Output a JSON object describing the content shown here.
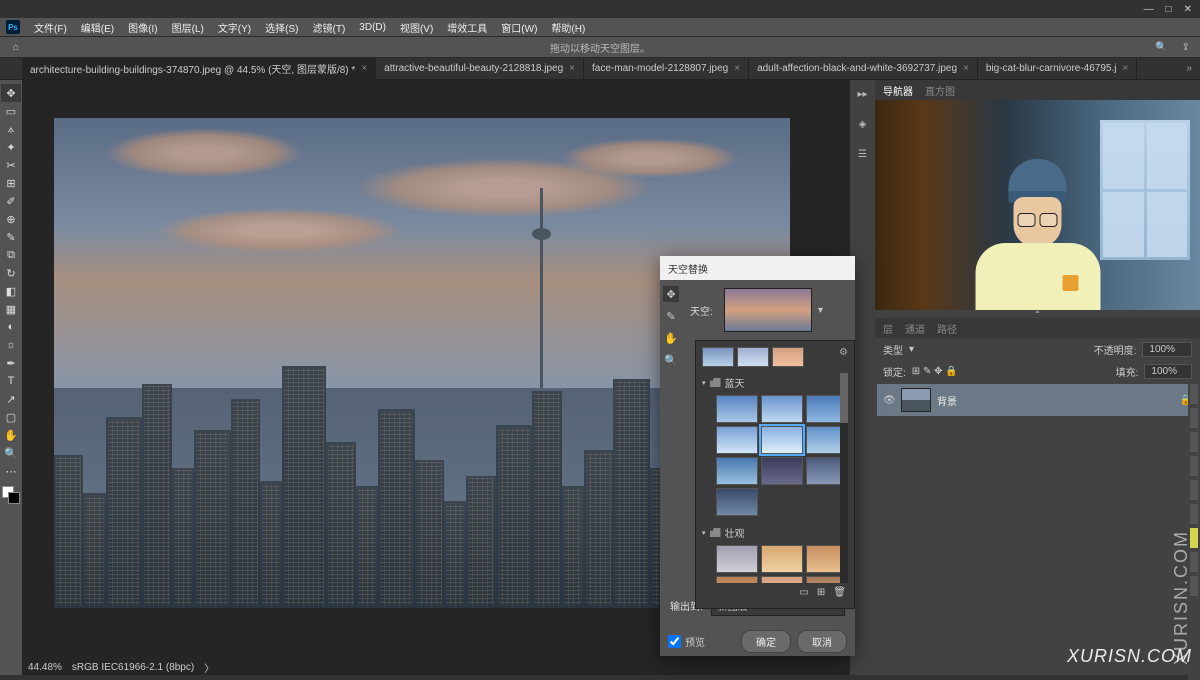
{
  "menubar": {
    "items": [
      "文件(F)",
      "编辑(E)",
      "图像(I)",
      "图层(L)",
      "文字(Y)",
      "选择(S)",
      "滤镜(T)",
      "3D(D)",
      "视图(V)",
      "增效工具",
      "窗口(W)",
      "帮助(H)"
    ]
  },
  "optbar": {
    "hint": "拖动以移动天空图层。"
  },
  "tabs": [
    {
      "label": "architecture-building-buildings-374870.jpeg @ 44.5% (天空, 图层蒙版/8) *",
      "active": true
    },
    {
      "label": "attractive-beautiful-beauty-2128818.jpeg",
      "active": false
    },
    {
      "label": "face-man-model-2128807.jpeg",
      "active": false
    },
    {
      "label": "adult-affection-black-and-white-3692737.jpeg",
      "active": false
    },
    {
      "label": "big-cat-blur-carnivore-46795.j",
      "active": false
    }
  ],
  "status": {
    "zoom": "44.48%",
    "profile": "sRGB IEC61966-2.1 (8bpc)"
  },
  "navigator": {
    "tab1": "导航器",
    "tab2": "直方图"
  },
  "layers": {
    "tab_layers": "层",
    "tab_channels": "通道",
    "tab_paths": "路径",
    "opacity_lbl": "不透明度:",
    "opacity_val": "100%",
    "fill_lbl": "填充:",
    "fill_val": "100%",
    "lock_lbl": "锁定:",
    "bg_layer": "背景"
  },
  "dialog": {
    "title": "天空替换",
    "sky_label": "天空:",
    "group_blue": "蓝天",
    "group_sunset": "壮观",
    "output_lbl": "输出到:",
    "output_val": "新图层",
    "preview": "预览",
    "ok": "确定",
    "cancel": "取消"
  },
  "watermark": "XURISN.COM",
  "watermark2": "XURISN.COM"
}
